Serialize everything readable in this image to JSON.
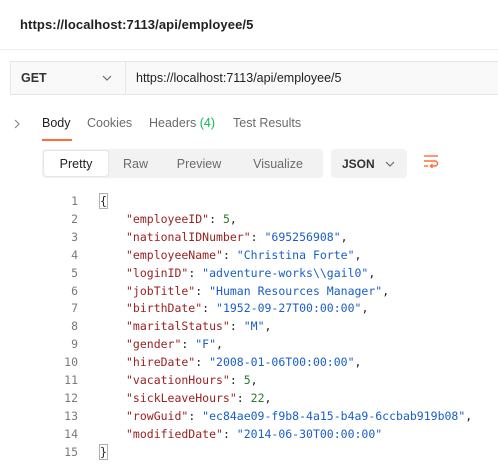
{
  "title": "https://localhost:7113/api/employee/5",
  "request": {
    "method": "GET",
    "url": "https://localhost:7113/api/employee/5"
  },
  "response_tabs": [
    {
      "label": "Body",
      "active": true
    },
    {
      "label": "Cookies",
      "active": false
    },
    {
      "label": "Headers",
      "count": "(4)",
      "active": false
    },
    {
      "label": "Test Results",
      "active": false
    }
  ],
  "view_modes": [
    "Pretty",
    "Raw",
    "Preview",
    "Visualize"
  ],
  "active_view_mode": "Pretty",
  "format": "JSON",
  "icons": {
    "method_dropdown": "chevron-down-icon",
    "collapse": "chevron-right-icon",
    "format_dropdown": "chevron-down-icon",
    "wrap": "wrap-lines-icon"
  },
  "colors": {
    "accent": "#ff6c37",
    "key": "#9c2121",
    "string": "#1a5ec7",
    "number": "#2a7b30",
    "count": "#0cbb52"
  },
  "body": {
    "open_brace": "{",
    "close_brace": "}",
    "fields": [
      {
        "line": "2",
        "key": "\"employeeID\"",
        "value": "5",
        "type": "number"
      },
      {
        "line": "3",
        "key": "\"nationalIDNumber\"",
        "value": "\"695256908\"",
        "type": "string"
      },
      {
        "line": "4",
        "key": "\"employeeName\"",
        "value": "\"Christina Forte\"",
        "type": "string"
      },
      {
        "line": "5",
        "key": "\"loginID\"",
        "value": "\"adventure-works\\\\gail0\"",
        "type": "string"
      },
      {
        "line": "6",
        "key": "\"jobTitle\"",
        "value": "\"Human Resources Manager\"",
        "type": "string"
      },
      {
        "line": "7",
        "key": "\"birthDate\"",
        "value": "\"1952-09-27T00:00:00\"",
        "type": "string"
      },
      {
        "line": "8",
        "key": "\"maritalStatus\"",
        "value": "\"M\"",
        "type": "string"
      },
      {
        "line": "9",
        "key": "\"gender\"",
        "value": "\"F\"",
        "type": "string"
      },
      {
        "line": "10",
        "key": "\"hireDate\"",
        "value": "\"2008-01-06T00:00:00\"",
        "type": "string"
      },
      {
        "line": "11",
        "key": "\"vacationHours\"",
        "value": "5",
        "type": "number"
      },
      {
        "line": "12",
        "key": "\"sickLeaveHours\"",
        "value": "22",
        "type": "number"
      },
      {
        "line": "13",
        "key": "\"rowGuid\"",
        "value": "\"ec84ae09-f9b8-4a15-b4a9-6ccbab919b08\"",
        "type": "string"
      },
      {
        "line": "14",
        "key": "\"modifiedDate\"",
        "value": "\"2014-06-30T00:00:00\"",
        "type": "string"
      }
    ],
    "first_line": "1",
    "last_line": "15"
  }
}
